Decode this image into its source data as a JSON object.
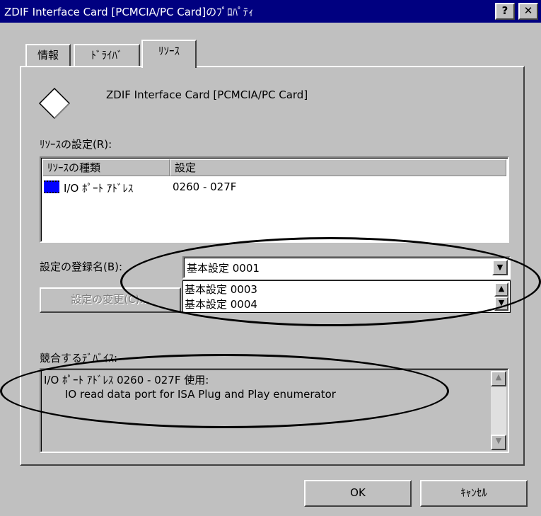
{
  "window": {
    "title": "ZDIF Interface Card [PCMCIA/PC Card]のﾌﾟﾛﾊﾟﾃｨ",
    "help_button": "?",
    "close_button": "✕"
  },
  "tabs": [
    {
      "label": "情報"
    },
    {
      "label": "ﾄﾞﾗｲﾊﾞ"
    },
    {
      "label": "ﾘｿｰｽ",
      "active": true
    }
  ],
  "device": {
    "name": "ZDIF Interface Card [PCMCIA/PC Card]",
    "icon": "diamond-icon"
  },
  "resources": {
    "label": "ﾘｿｰｽの設定(R):",
    "columns": [
      "ﾘｿｰｽの種類",
      "設定"
    ],
    "rows": [
      {
        "type": "I/O ﾎﾟｰﾄ ｱﾄﾞﾚｽ",
        "setting": "0260 - 027F",
        "icon": "io-port-icon"
      }
    ]
  },
  "config": {
    "label": "設定の登録名(B):",
    "selected": "基本設定 0001",
    "options": [
      "基本設定 0003",
      "基本設定 0004"
    ],
    "change_button": "設定の変更(C)..."
  },
  "conflict": {
    "label": "競合するﾃﾞﾊﾞｲｽ:",
    "line1": "I/O ﾎﾟｰﾄ ｱﾄﾞﾚｽ 0260 - 027F 使用:",
    "line2": "IO read data port for ISA Plug and Play enumerator"
  },
  "buttons": {
    "ok": "OK",
    "cancel": "ｷｬﾝｾﾙ"
  },
  "colors": {
    "titlebar": "#000080",
    "face": "#c0c0c0",
    "io_icon": "#0000ff"
  }
}
